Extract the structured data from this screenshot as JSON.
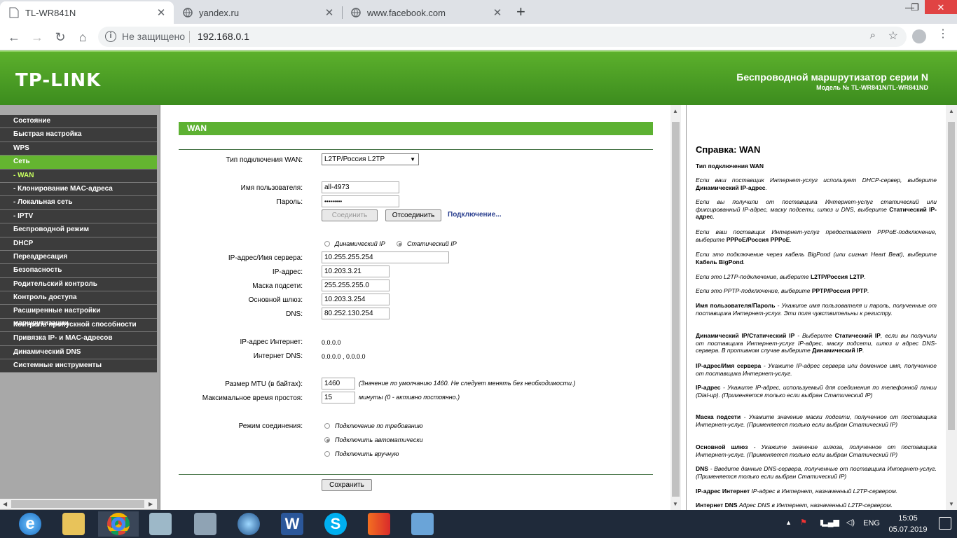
{
  "browser": {
    "tabs": [
      {
        "title": "TL-WR841N",
        "active": true
      },
      {
        "title": "yandex.ru",
        "active": false
      },
      {
        "title": "www.facebook.com",
        "active": false
      }
    ],
    "security_label": "Не защищено",
    "url": "192.168.0.1"
  },
  "header": {
    "logo": "TP-LINK",
    "title": "Беспроводной маршрутизатор серии N",
    "model": "Модель № TL-WR841N/TL-WR841ND"
  },
  "sidebar": {
    "items": [
      {
        "label": "Состояние"
      },
      {
        "label": "Быстрая настройка"
      },
      {
        "label": "WPS"
      },
      {
        "label": "Сеть"
      },
      {
        "label": "- WAN"
      },
      {
        "label": "- Клонирование MAC-адреса"
      },
      {
        "label": "- Локальная сеть"
      },
      {
        "label": "- IPTV"
      },
      {
        "label": "Беспроводной режим"
      },
      {
        "label": "DHCP"
      },
      {
        "label": "Переадресация"
      },
      {
        "label": "Безопасность"
      },
      {
        "label": "Родительский контроль"
      },
      {
        "label": "Контроль доступа"
      },
      {
        "label": "Расширенные настройки маршрутизации"
      },
      {
        "label": "Контроль пропускной способности"
      },
      {
        "label": "Привязка IP- и MAC-адресов"
      },
      {
        "label": "Динамический DNS"
      },
      {
        "label": "Системные инструменты"
      }
    ]
  },
  "wan": {
    "heading": "WAN",
    "type_label": "Тип подключения WAN:",
    "type_value": "L2TP/Россия L2TP",
    "user_label": "Имя пользователя:",
    "user_value": "all-4973",
    "pass_label": "Пароль:",
    "pass_value": "•••••••••",
    "connect_btn": "Соединить",
    "disconnect_btn": "Отсоединить",
    "connecting": "Подключение...",
    "dynamic_ip": "Динамический IP",
    "static_ip": "Статический IP",
    "server_label": "IP-адрес/Имя сервера:",
    "server_value": "10.255.255.254",
    "ip_label": "IP-адрес:",
    "ip_value": "10.203.3.21",
    "mask_label": "Маска подсети:",
    "mask_value": "255.255.255.0",
    "gw_label": "Основной шлюз:",
    "gw_value": "10.203.3.254",
    "dns_label": "DNS:",
    "dns_value": "80.252.130.254",
    "inet_ip_label": "IP-адрес Интернет:",
    "inet_ip_value": "0.0.0.0",
    "inet_dns_label": "Интернет DNS:",
    "inet_dns_value": "0.0.0.0 , 0.0.0.0",
    "mtu_label": "Размер MTU (в байтах):",
    "mtu_value": "1460",
    "mtu_note": "(Значение по умолчанию 1460. Не следует менять без необходимости.)",
    "idle_label": "Максимальное время простоя:",
    "idle_value": "15",
    "idle_note": "минуты (0 - активно постоянно.)",
    "mode_label": "Режим соединения:",
    "mode_options": [
      "Подключение по требованию",
      "Подключить автоматически",
      "Подключить вручную"
    ],
    "save_btn": "Сохранить"
  },
  "help": {
    "title": "Справка: WAN",
    "subtitle": "Тип подключения WAN"
  },
  "taskbar": {
    "lang": "ENG",
    "time": "15:05",
    "date": "05.07.2019"
  }
}
